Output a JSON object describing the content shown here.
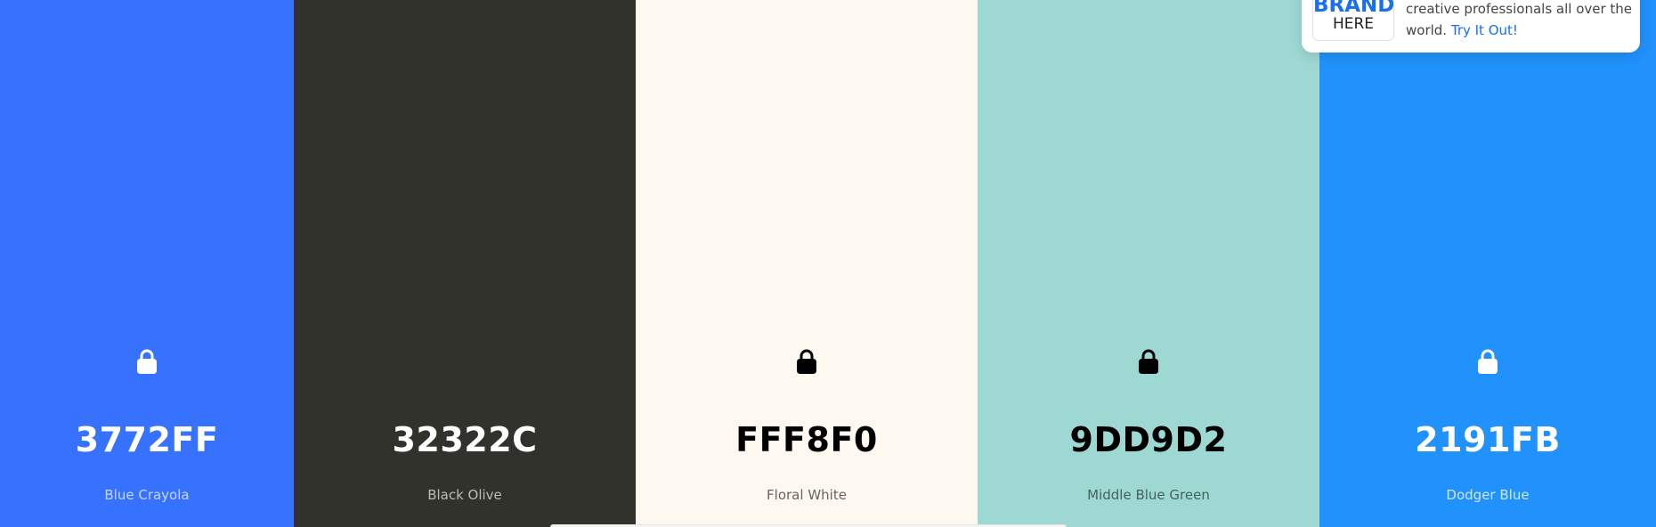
{
  "swatches": [
    {
      "hex": "3772FF",
      "name": "Blue Crayola",
      "bg": "#3772FF",
      "hex_color": "#FFFFFF",
      "name_color": "#C9D6FF",
      "lock_color": "#FFFFFF",
      "lock_icon": "lock-icon",
      "show_lock": true
    },
    {
      "hex": "32322C",
      "name": "Black Olive",
      "bg": "#32322C",
      "hex_color": "#FFFFFF",
      "name_color": "#BDBDB6",
      "lock_color": "#FFFFFF",
      "lock_icon": "lock-icon",
      "show_lock": false
    },
    {
      "hex": "FFF8F0",
      "name": "Floral White",
      "bg": "#FFF8F0",
      "hex_color": "#000000",
      "name_color": "#6A6560",
      "lock_color": "#000000",
      "lock_icon": "lock-icon",
      "show_lock": true
    },
    {
      "hex": "9DD9D2",
      "name": "Middle Blue Green",
      "bg": "#9DD9D2",
      "hex_color": "#000000",
      "name_color": "#46615E",
      "lock_color": "#000000",
      "lock_icon": "lock-icon",
      "show_lock": true
    },
    {
      "hex": "2191FB",
      "name": "Dodger Blue",
      "bg": "#2191FB",
      "hex_color": "#FFFFFF",
      "name_color": "#CFE6FF",
      "lock_color": "#FFFFFF",
      "lock_icon": "lock-icon",
      "show_lock": true
    }
  ],
  "ad": {
    "logo_line1": "BRAND",
    "logo_line2": "HERE",
    "text_line1": "creative professionals all over the",
    "text_line2": "world.",
    "link_text": "Try It Out!",
    "accent": "#1A6EF0"
  }
}
